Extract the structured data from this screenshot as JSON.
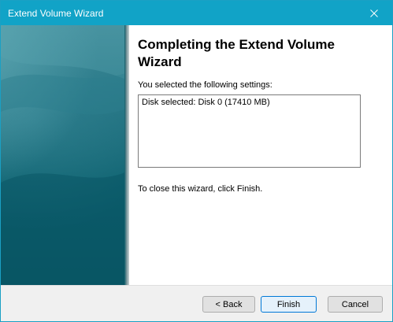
{
  "window": {
    "title": "Extend Volume Wizard"
  },
  "icons": {
    "close": "close-icon"
  },
  "colors": {
    "titlebar": "#11a3c7",
    "side_panel": "#0e6270"
  },
  "main": {
    "heading": "Completing the Extend Volume Wizard",
    "settings_label": "You selected the following settings:",
    "settings": [
      "Disk selected: Disk 0 (17410 MB)"
    ],
    "close_hint": "To close this wizard, click Finish."
  },
  "footer": {
    "back_label": "< Back",
    "finish_label": "Finish",
    "cancel_label": "Cancel"
  }
}
